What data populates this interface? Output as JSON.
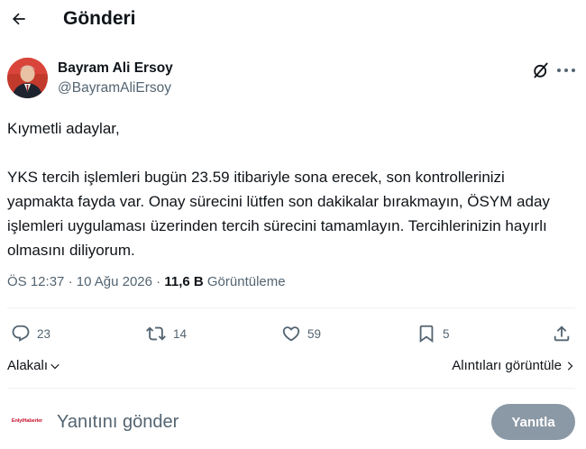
{
  "header": {
    "title": "Gönderi"
  },
  "author": {
    "name": "Bayram Ali Ersoy",
    "handle": "@BayramAliErsoy"
  },
  "tweet": {
    "paragraphs": [
      "Kıymetli adaylar,",
      "YKS tercih işlemleri bugün 23.59 itibariyle sona erecek, son kontrollerinizi yapmakta fayda var. Onay sürecini lütfen son dakikalar bırakmayın, ÖSYM aday işlemleri uygulaması üzerinden tercih sürecini tamamlayın. Tercihlerinizin hayırlı olmasını diliyorum."
    ],
    "time": "ÖS 12:37",
    "date": "10 Ağu 2026",
    "views_count": "11,6 B",
    "views_label": "Görüntüleme",
    "separator": "·"
  },
  "actions": {
    "replies": "23",
    "reposts": "14",
    "likes": "59",
    "bookmarks": "5"
  },
  "related": {
    "relevant_label": "Alakalı",
    "quotes_label": "Alıntıları görüntüle"
  },
  "reply_bar": {
    "avatar_text": "EnIyiHaberler",
    "placeholder": "Yanıtını gönder",
    "button_label": "Yanıtla"
  },
  "colors": {
    "text_primary": "#0f1419",
    "text_secondary": "#536471",
    "divider": "#eff3f4",
    "reply_button_disabled": "#8b98a5",
    "reply_avatar_brand": "#c8102e"
  },
  "icons": {
    "back": "arrow-left-icon",
    "grok": "grok-icon",
    "more": "more-icon",
    "reply": "reply-icon",
    "repost": "repost-icon",
    "like": "heart-icon",
    "bookmark": "bookmark-icon",
    "share": "share-icon",
    "relevant_dropdown": "chevron-down-icon",
    "quotes_arrow": "chevron-right-icon"
  }
}
